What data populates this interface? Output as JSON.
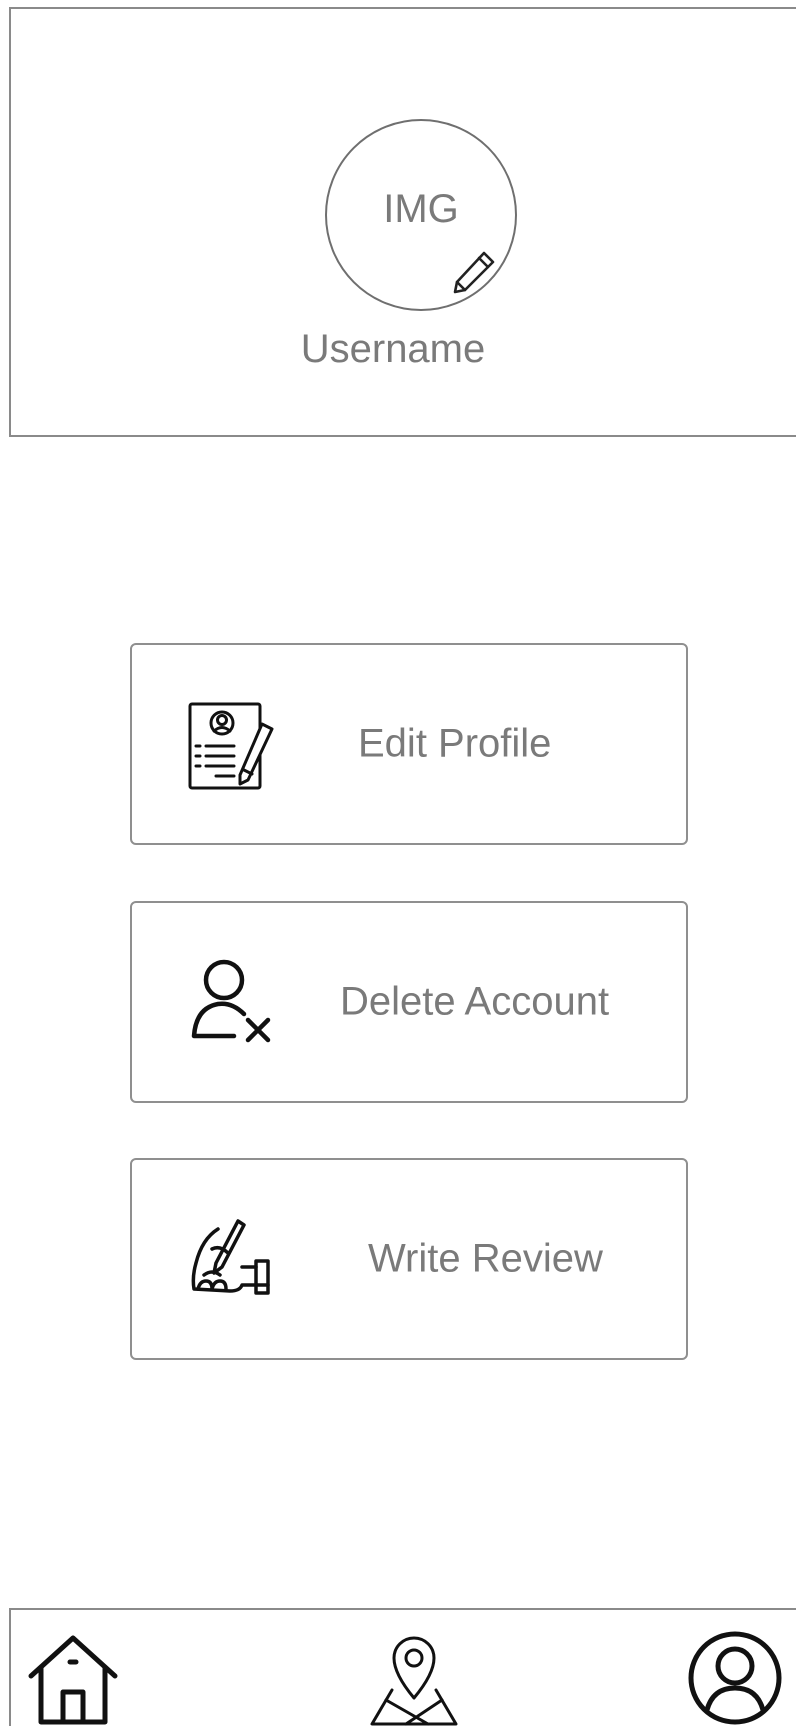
{
  "header": {
    "avatar_placeholder": "IMG",
    "username": "Username"
  },
  "actions": [
    {
      "label": "Edit Profile",
      "icon": "edit-profile-icon"
    },
    {
      "label": "Delete Account",
      "icon": "delete-user-icon"
    },
    {
      "label": "Write Review",
      "icon": "write-review-icon"
    }
  ],
  "bottom_nav": [
    {
      "icon": "home-icon"
    },
    {
      "icon": "map-pin-icon"
    },
    {
      "icon": "user-profile-icon"
    }
  ],
  "colors": {
    "border": "#8a8a8a",
    "text": "#7a7a7a",
    "icon": "#111111",
    "background": "#ffffff"
  }
}
